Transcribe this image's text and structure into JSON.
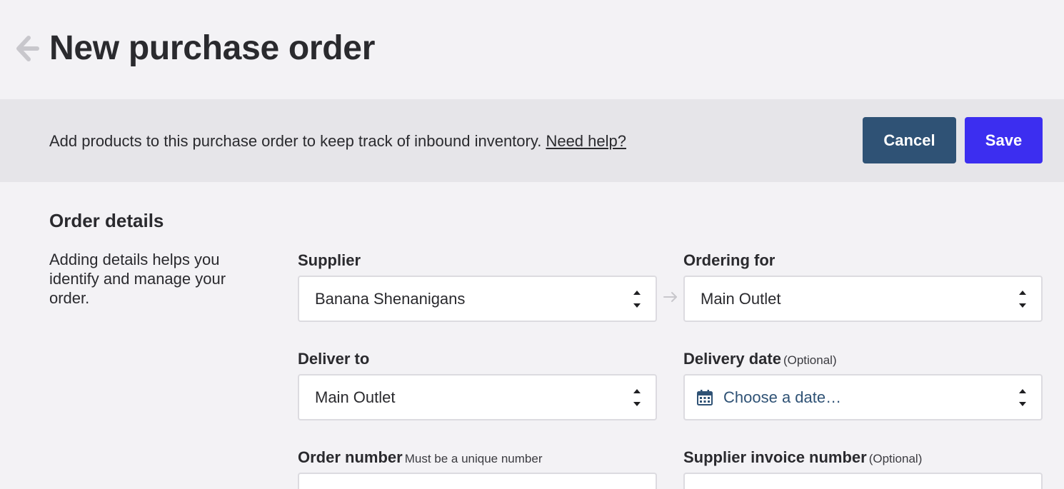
{
  "header": {
    "title": "New purchase order",
    "back_icon": "arrow-left-icon"
  },
  "banner": {
    "text": "Add products to this purchase order to keep track of inbound inventory.",
    "help_link": "Need help?",
    "cancel_label": "Cancel",
    "save_label": "Save"
  },
  "section": {
    "title": "Order details",
    "description": "Adding details helps you identify and manage your order."
  },
  "fields": {
    "supplier": {
      "label": "Supplier",
      "value": "Banana Shenanigans"
    },
    "ordering_for": {
      "label": "Ordering for",
      "value": "Main Outlet"
    },
    "deliver_to": {
      "label": "Deliver to",
      "value": "Main Outlet"
    },
    "delivery_date": {
      "label": "Delivery date",
      "hint": "(Optional)",
      "placeholder": "Choose a date…",
      "icon": "calendar-icon"
    },
    "order_number": {
      "label": "Order number",
      "hint": "Must be a unique number"
    },
    "supplier_invoice_number": {
      "label": "Supplier invoice number",
      "hint": "(Optional)"
    }
  },
  "colors": {
    "background": "#f3f2f5",
    "banner": "#e6e5e9",
    "cancel_button": "#2f5275",
    "save_button": "#3c2ef0",
    "placeholder_text": "#2f5275",
    "text": "#2a2a2e"
  }
}
